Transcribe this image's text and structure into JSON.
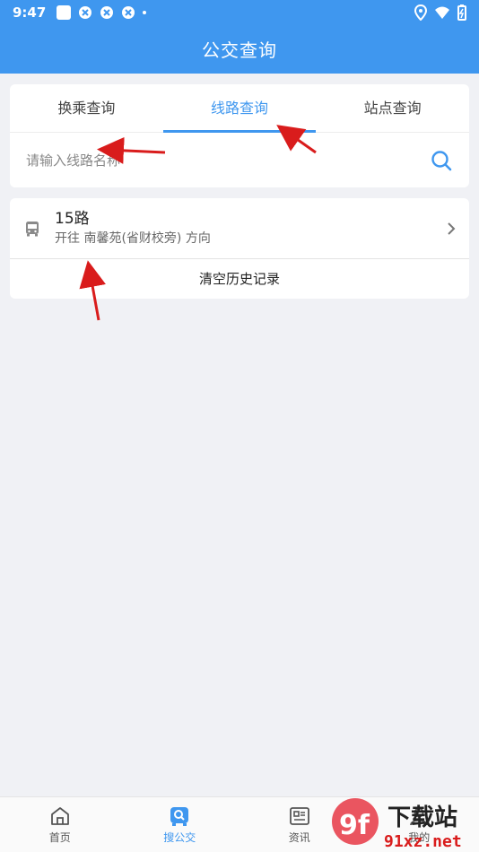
{
  "status_bar": {
    "time": "9:47"
  },
  "header": {
    "title": "公交查询"
  },
  "tabs": [
    {
      "label": "换乘查询",
      "active": false
    },
    {
      "label": "线路查询",
      "active": true
    },
    {
      "label": "站点查询",
      "active": false
    }
  ],
  "search": {
    "placeholder": "请输入线路名称",
    "value": ""
  },
  "history": {
    "items": [
      {
        "route": "15路",
        "direction": "开往 南馨苑(省财校旁) 方向"
      }
    ],
    "clear_label": "清空历史记录"
  },
  "bottom_nav": [
    {
      "label": "首页",
      "icon": "home-icon"
    },
    {
      "label": "搜公交",
      "icon": "bus-search-icon",
      "active": true
    },
    {
      "label": "资讯",
      "icon": "news-icon"
    },
    {
      "label": "我的",
      "icon": "user-icon"
    }
  ],
  "watermark": {
    "text_top": "下载站",
    "text_bottom": "91xz.net",
    "logo": "9f"
  },
  "colors": {
    "accent": "#3f97ef",
    "annotation": "#d91c1c"
  }
}
